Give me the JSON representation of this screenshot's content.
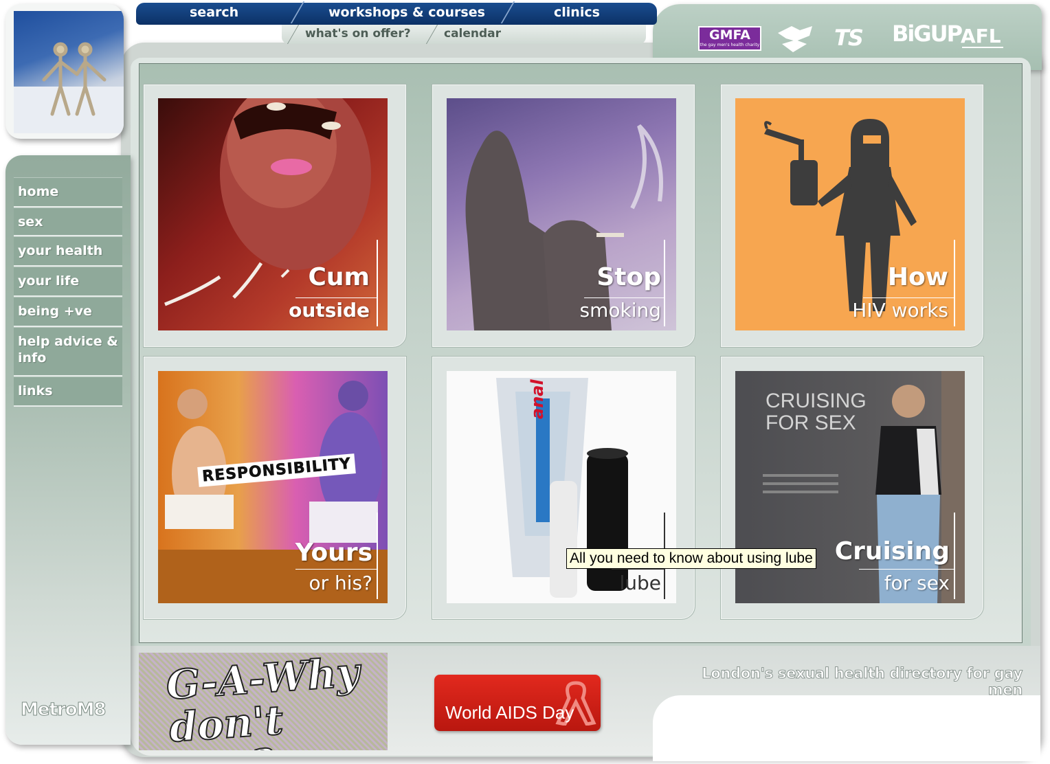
{
  "topnav": {
    "items": [
      "search",
      "workshops & courses",
      "clinics"
    ],
    "subitems": [
      "what's on offer?",
      "calendar"
    ]
  },
  "partners": {
    "gmfa": "GMFA",
    "gmfa_sub": "the gay men's health charity",
    "ts": "TS",
    "bigup": "BiGUP",
    "afl": "AFL"
  },
  "sidebar": {
    "items": [
      {
        "label": "home"
      },
      {
        "label": "sex"
      },
      {
        "label": "your health"
      },
      {
        "label": "your life"
      },
      {
        "label": "being +ve"
      },
      {
        "label": "help advice & info"
      },
      {
        "label": "links"
      }
    ],
    "brand": "MetroM8"
  },
  "tiles": [
    {
      "title": "Cum",
      "subtitle": "outside"
    },
    {
      "title": "Stop",
      "subtitle": "smoking"
    },
    {
      "title": "How",
      "subtitle": "HIV works"
    },
    {
      "title": "Yours",
      "subtitle": "or his?",
      "image_text": "RESPONSIBILITY"
    },
    {
      "title": "",
      "subtitle": "lube",
      "image_text": "anal"
    },
    {
      "title": "Cruising",
      "subtitle": "for sex",
      "image_text": "CRUISING FOR SEX"
    }
  ],
  "tooltip": "All you need to know about using lube",
  "footer": {
    "gawhy": "G-A-Why don't you?",
    "aids_day": "World AIDS Day",
    "tagline": "London's sexual health directory for gay men"
  },
  "colors": {
    "nav_blue": "#0c3166",
    "nav_green": "#8fa99a",
    "aids_red": "#d5231a",
    "gmfa_purple": "#7b2c9b"
  }
}
